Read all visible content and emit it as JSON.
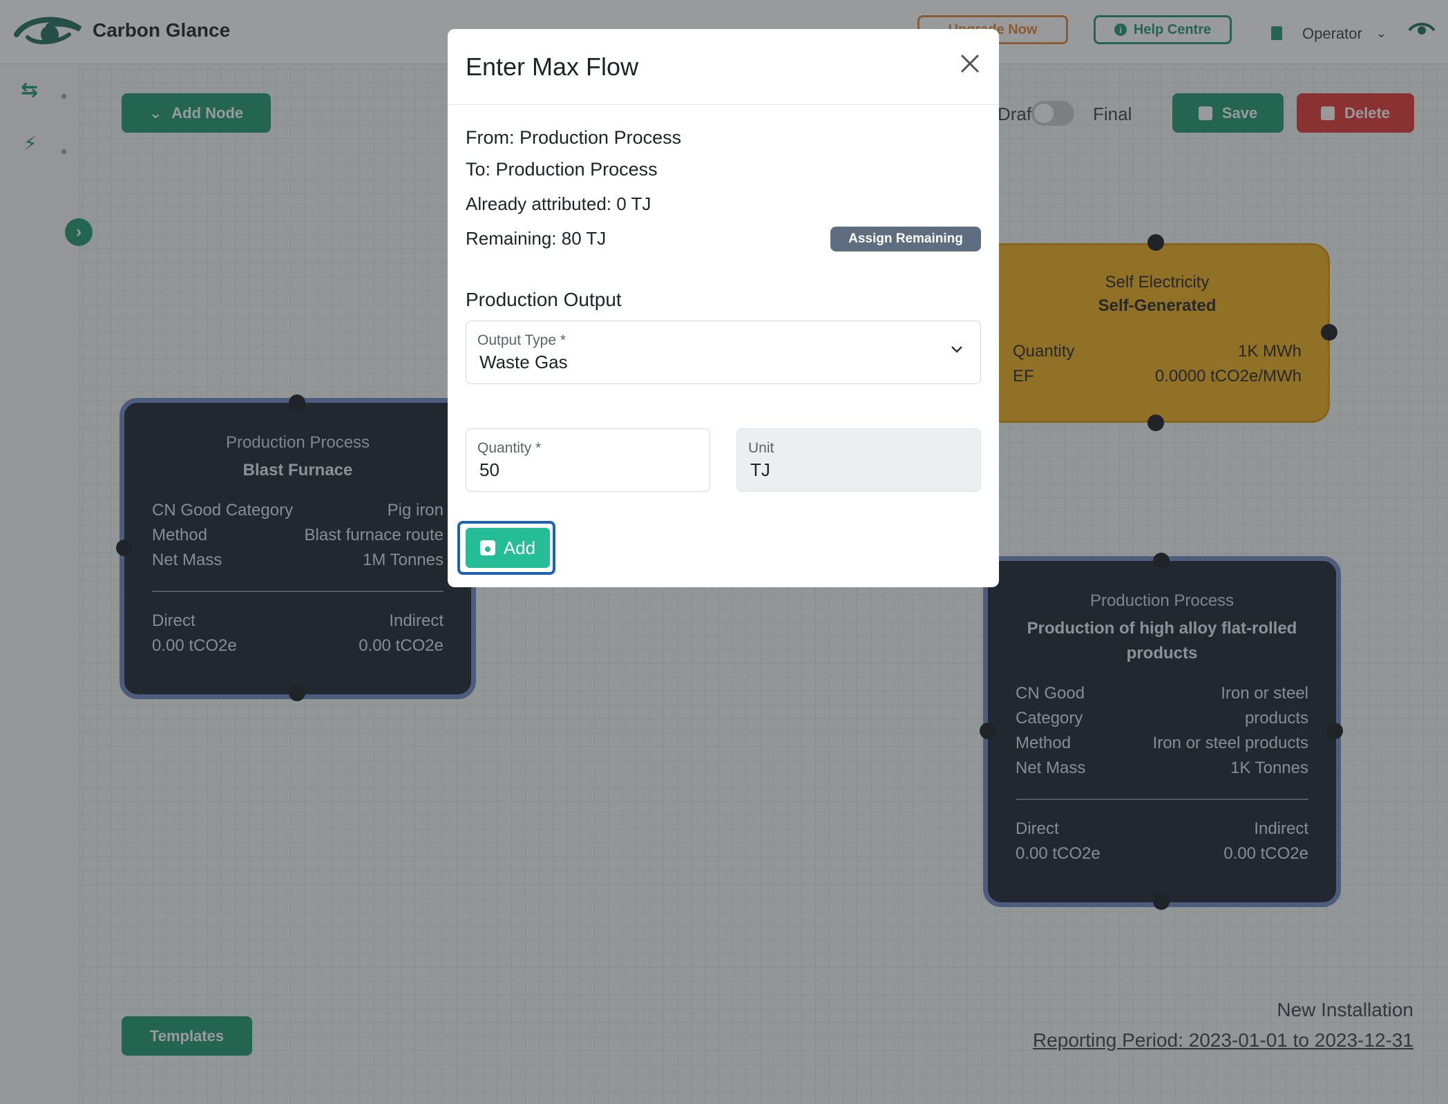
{
  "header": {
    "brand": "Carbon Glance",
    "upgrade_label": "Upgrade Now",
    "help_label": "Help Centre",
    "role": "Operator"
  },
  "toolbar": {
    "add_node_label": "Add Node",
    "draft_label": "Draft",
    "final_label": "Final",
    "save_label": "Save",
    "delete_label": "Delete",
    "templates_label": "Templates"
  },
  "nodes": {
    "blast_furnace": {
      "title": "Production Process",
      "subtitle": "Blast Furnace",
      "rows": [
        {
          "k": "CN Good Category",
          "v": "Pig iron"
        },
        {
          "k": "Method",
          "v": "Blast furnace route"
        },
        {
          "k": "Net Mass",
          "v": "1M Tonnes"
        }
      ],
      "direct_label": "Direct",
      "direct_value": "0.00 tCO2e",
      "indirect_label": "Indirect",
      "indirect_value": "0.00 tCO2e"
    },
    "self_electricity": {
      "title": "Self Electricity",
      "subtitle": "Self-Generated",
      "rows": [
        {
          "k": "Quantity",
          "v": "1K MWh"
        },
        {
          "k": "EF",
          "v": "0.0000 tCO2e/MWh"
        }
      ]
    },
    "flat_rolled": {
      "title": "Production Process",
      "subtitle": "Production of high alloy flat-rolled products",
      "rows": [
        {
          "k": "CN Good Category",
          "v": "Iron or steel products"
        },
        {
          "k": "Method",
          "v": "Iron or steel products"
        },
        {
          "k": "Net Mass",
          "v": "1K Tonnes"
        }
      ],
      "direct_label": "Direct",
      "direct_value": "0.00 tCO2e",
      "indirect_label": "Indirect",
      "indirect_value": "0.00 tCO2e"
    }
  },
  "footer": {
    "installation": "New Installation",
    "reporting_period": "Reporting Period: 2023-01-01 to 2023-12-31"
  },
  "modal": {
    "title": "Enter Max Flow",
    "from": "From: Production Process",
    "to": "To: Production Process",
    "already_attributed": "Already attributed: 0 TJ",
    "remaining": "Remaining: 80 TJ",
    "assign_label": "Assign Remaining",
    "section_title": "Production Output",
    "output_type_label": "Output Type *",
    "output_type_value": "Waste Gas",
    "quantity_label": "Quantity *",
    "quantity_value": "50",
    "unit_label": "Unit",
    "unit_value": "TJ",
    "add_label": "Add"
  },
  "colors": {
    "brand_green": "#1f9a6c",
    "delete_red": "#e53935",
    "node_dark": "#1e2530",
    "node_yellow": "#f0b01c",
    "add_teal": "#25bd95"
  }
}
